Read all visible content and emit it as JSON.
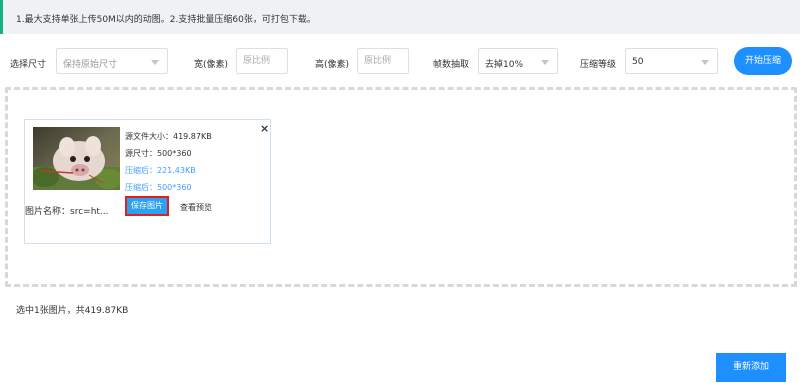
{
  "notice": {
    "text": "1.最大支持单张上传50M以内的动图。2.支持批量压缩60张，可打包下载。"
  },
  "controls": {
    "size_label": "选择尺寸",
    "size_value": "保持原始尺寸",
    "width_label": "宽(像素)",
    "width_placeholder": "原比例",
    "height_label": "高(像素)",
    "height_placeholder": "原比例",
    "frame_label": "帧数抽取",
    "frame_value": "去掉10%",
    "level_label": "压缩等级",
    "level_value": "50",
    "start_button": "开始压缩"
  },
  "file_card": {
    "original_size": "源文件大小：419.87KB",
    "original_dims": "源尺寸：500*360",
    "compressed_size": "压缩后：221.43KB",
    "compressed_dims": "压缩后：500*360",
    "name_label": "图片名称：",
    "name_value": "src=ht...",
    "save_button": "保存图片",
    "preview_link": "查看预览",
    "close_symbol": "×"
  },
  "summary": {
    "text": "选中1张图片，共419.87KB"
  },
  "readd_button": "重新添加",
  "colors": {
    "accent": "#1e8ffe",
    "notice_bar": "#18b07f",
    "compressed_text": "#409eff",
    "highlight_border": "#e02020"
  }
}
